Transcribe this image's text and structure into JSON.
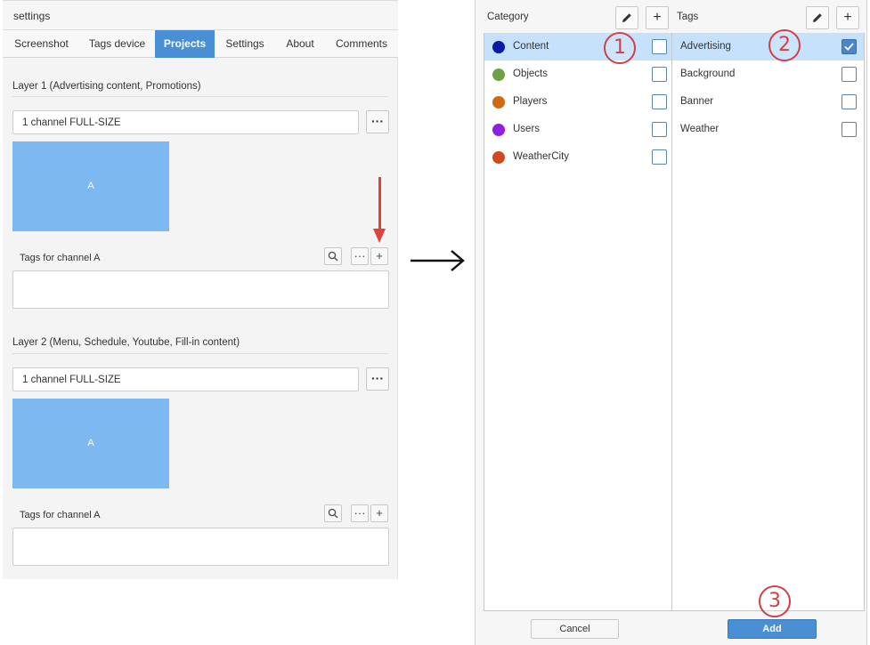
{
  "settings": {
    "title": "settings",
    "tabs": [
      {
        "label": "Screenshot"
      },
      {
        "label": "Tags device"
      },
      {
        "label": "Projects",
        "active": true
      },
      {
        "label": "Settings"
      },
      {
        "label": "About"
      },
      {
        "label": "Comments"
      }
    ],
    "layers": [
      {
        "title": "Layer 1 (Advertising content, Promotions)",
        "channel_value": "1 channel FULL-SIZE",
        "more_label": "···",
        "preview_label": "A",
        "tags_label": "Tags for channel A",
        "add_label": "+"
      },
      {
        "title": "Layer 2 (Menu, Schedule, Youtube, Fill-in content)",
        "channel_value": "1 channel FULL-SIZE",
        "more_label": "···",
        "preview_label": "A",
        "tags_label": "Tags for channel A",
        "add_label": "+"
      }
    ]
  },
  "dialog": {
    "category_header": "Category",
    "tags_header": "Tags",
    "edit_label": "✎",
    "add_label": "+",
    "categories": [
      {
        "label": "Content",
        "color": "#0a1aa8",
        "selected": true,
        "checked": false
      },
      {
        "label": "Objects",
        "color": "#6ea046",
        "selected": false,
        "checked": false
      },
      {
        "label": "Players",
        "color": "#d06a10",
        "selected": false,
        "checked": false
      },
      {
        "label": "Users",
        "color": "#9020e0",
        "selected": false,
        "checked": false
      },
      {
        "label": "WeatherCity",
        "color": "#d04a20",
        "selected": false,
        "checked": false
      }
    ],
    "tags": [
      {
        "label": "Advertising",
        "selected": true,
        "checked": true
      },
      {
        "label": "Background",
        "selected": false,
        "checked": false
      },
      {
        "label": "Banner",
        "selected": false,
        "checked": false
      },
      {
        "label": "Weather",
        "selected": false,
        "checked": false
      }
    ],
    "callouts": [
      "1",
      "2",
      "3"
    ],
    "cancel_label": "Cancel",
    "add_button_label": "Add"
  },
  "colors": {
    "accent": "#4a8fd4",
    "selection": "#c5e1fb",
    "callout": "#d04048",
    "pointer_arrow": "#e0413a"
  }
}
